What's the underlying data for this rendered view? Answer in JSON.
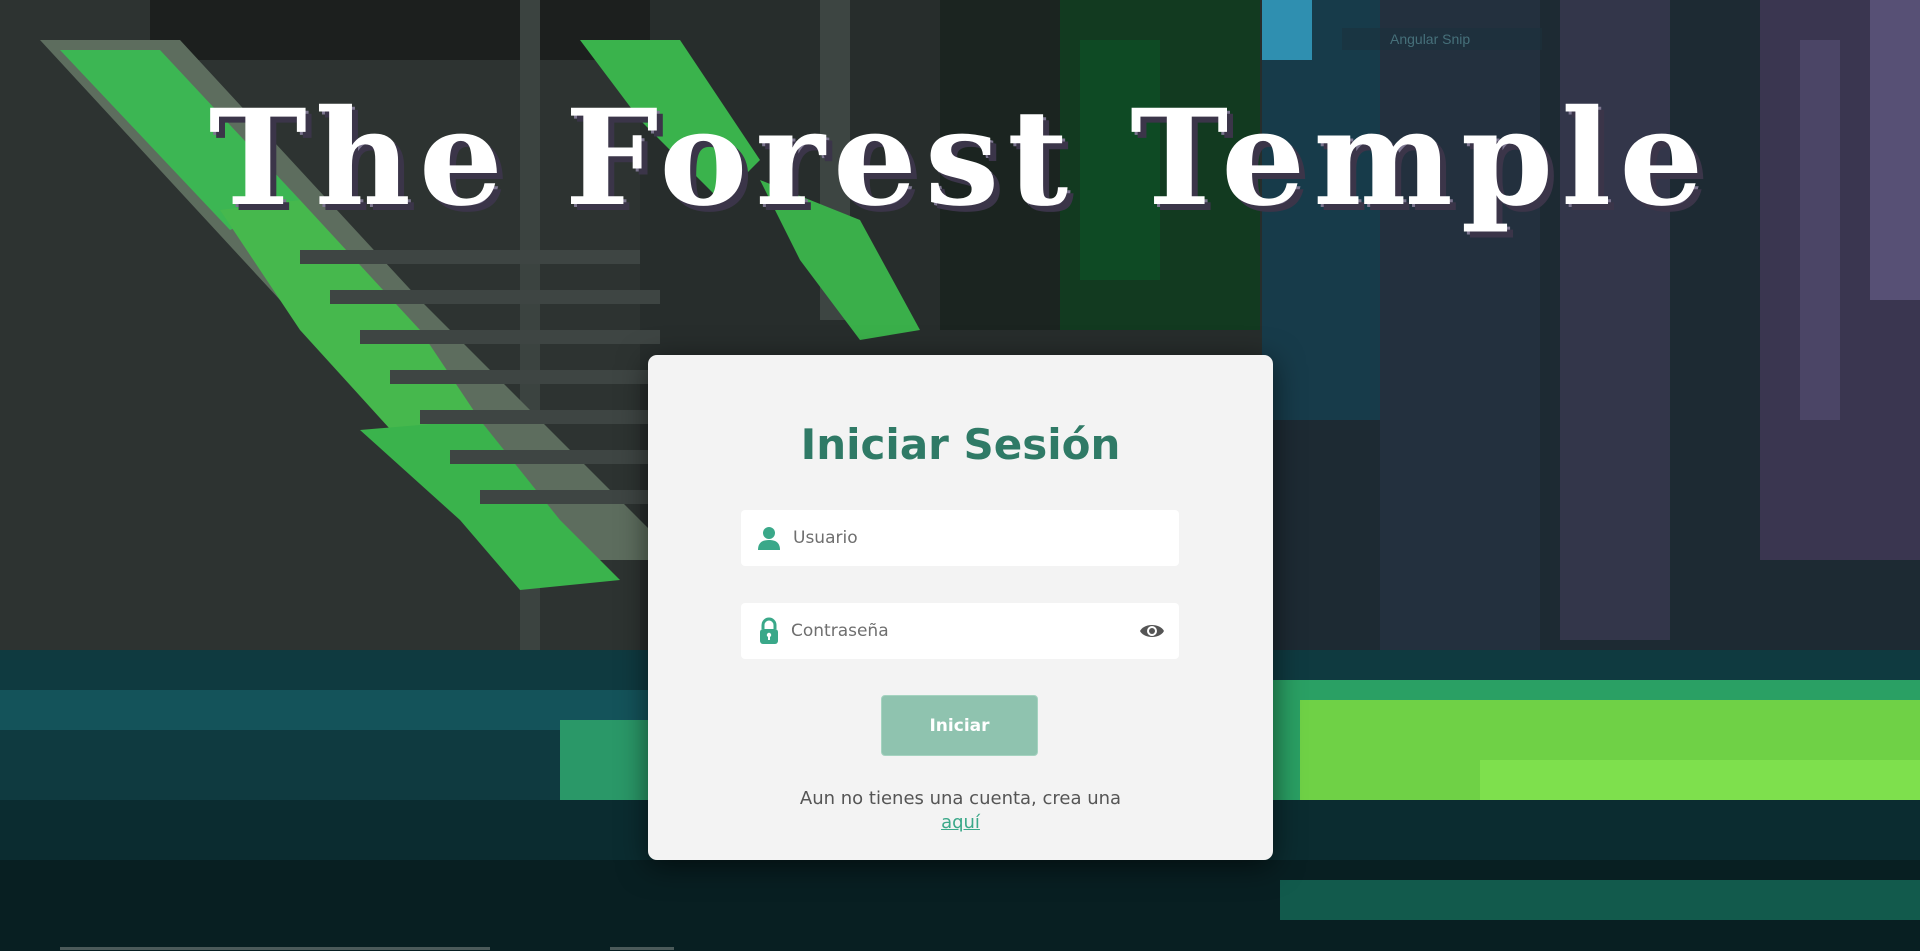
{
  "page": {
    "title": "The Forest Temple",
    "overlay_snip_label": "Angular Snip"
  },
  "login": {
    "heading": "Iniciar Sesión",
    "username_placeholder": "Usuario",
    "username_value": "",
    "username_icon": "user-icon",
    "password_placeholder": "Contraseña",
    "password_value": "",
    "password_icon": "lock-icon",
    "toggle_visibility_icon": "eye-icon",
    "submit_label": "Iniciar",
    "signup_prompt": "Aun no tienes una cuenta, crea una",
    "signup_link": "aquí"
  },
  "colors": {
    "accent": "#2f7a66",
    "button": "#8fc3af",
    "link": "#3aa889",
    "icon": "#3aa889",
    "card": "#f3f3f3"
  }
}
